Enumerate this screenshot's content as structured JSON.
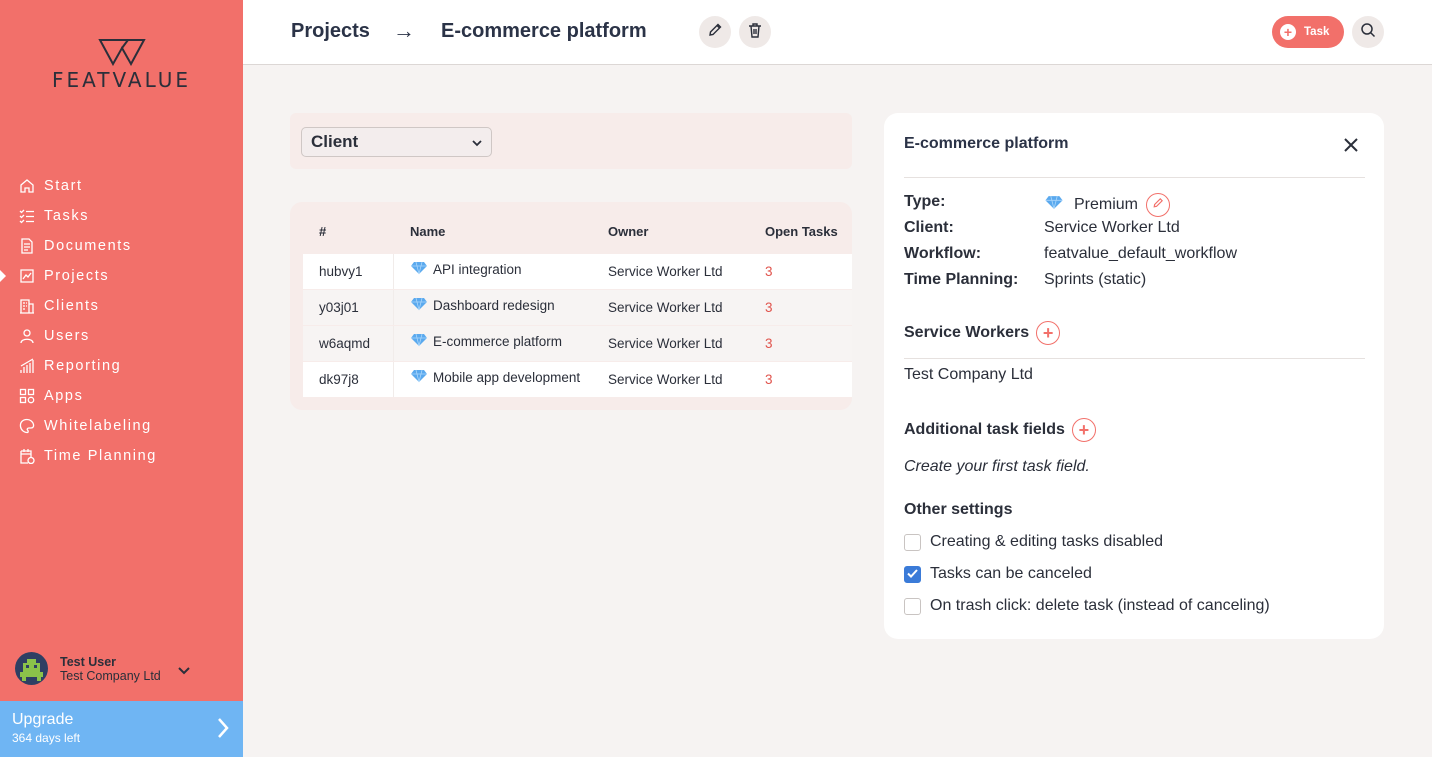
{
  "app": {
    "logo_text": "FEATVALUE"
  },
  "sidebar": {
    "items": [
      {
        "label": "Start",
        "icon": "home-icon"
      },
      {
        "label": "Tasks",
        "icon": "checklist-icon"
      },
      {
        "label": "Documents",
        "icon": "document-icon"
      },
      {
        "label": "Projects",
        "icon": "projects-icon"
      },
      {
        "label": "Clients",
        "icon": "building-icon"
      },
      {
        "label": "Users",
        "icon": "user-icon"
      },
      {
        "label": "Reporting",
        "icon": "chart-icon"
      },
      {
        "label": "Apps",
        "icon": "apps-icon"
      },
      {
        "label": "Whitelabeling",
        "icon": "palette-icon"
      },
      {
        "label": "Time Planning",
        "icon": "calendar-icon"
      }
    ],
    "active": "Projects",
    "user": {
      "name": "Test User",
      "company": "Test Company Ltd"
    },
    "upgrade": {
      "title": "Upgrade",
      "subtitle": "364 days left"
    }
  },
  "header": {
    "crumb_parent": "Projects",
    "crumb_arrow": "→",
    "crumb_current": "E-commerce platform",
    "task_button": "Task"
  },
  "filter": {
    "selected": "Client"
  },
  "table": {
    "headers": {
      "id": "#",
      "name": "Name",
      "owner": "Owner",
      "open": "Open Tasks"
    },
    "rows": [
      {
        "id": "hubvy1",
        "name": "API integration",
        "owner": "Service Worker Ltd",
        "open": "3"
      },
      {
        "id": "y03j01",
        "name": "Dashboard redesign",
        "owner": "Service Worker Ltd",
        "open": "3"
      },
      {
        "id": "w6aqmd",
        "name": "E-commerce platform",
        "owner": "Service Worker Ltd",
        "open": "3"
      },
      {
        "id": "dk97j8",
        "name": "Mobile app development",
        "owner": "Service Worker Ltd",
        "open": "3"
      }
    ]
  },
  "panel": {
    "title": "E-commerce platform",
    "fields": {
      "type_label": "Type:",
      "type_value": "Premium",
      "client_label": "Client:",
      "client_value": "Service Worker Ltd",
      "workflow_label": "Workflow:",
      "workflow_value": "featvalue_default_workflow",
      "time_label": "Time Planning:",
      "time_value": "Sprints (static)"
    },
    "service_workers_title": "Service Workers",
    "service_workers": [
      "Test Company Ltd"
    ],
    "task_fields_title": "Additional task fields",
    "task_fields_empty": "Create your first task field.",
    "other_settings_title": "Other settings",
    "settings": [
      {
        "label": "Creating & editing tasks disabled",
        "checked": false
      },
      {
        "label": "Tasks can be canceled",
        "checked": true
      },
      {
        "label": "On trash click: delete task (instead of canceling)",
        "checked": false
      }
    ]
  },
  "colors": {
    "sidebar": "#f2706a",
    "accent": "#f2706a",
    "upgrade": "#6fb5f3",
    "checkbox": "#3b7bd8",
    "open_tasks": "#e0534c"
  }
}
